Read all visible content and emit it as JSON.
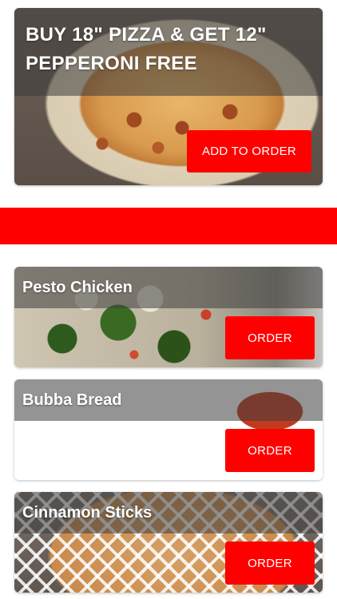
{
  "promo": {
    "title": "BUY 18\" PIZZA & GET 12\" PEPPERONI FREE",
    "button_label": "ADD TO ORDER",
    "image_icon": "pizza-photo"
  },
  "menu_items": [
    {
      "name": "Pesto Chicken",
      "button_label": "ORDER",
      "image_icon": "pesto-chicken-pizza-photo"
    },
    {
      "name": "Bubba Bread",
      "button_label": "ORDER",
      "image_icon": "breadsticks-with-sauce-photo"
    },
    {
      "name": "Cinnamon Sticks",
      "button_label": "ORDER",
      "image_icon": "cinnamon-sticks-photo"
    }
  ],
  "colors": {
    "accent": "#ff0000",
    "overlay": "#3c3c3c",
    "text_on_overlay": "#ffffff"
  }
}
